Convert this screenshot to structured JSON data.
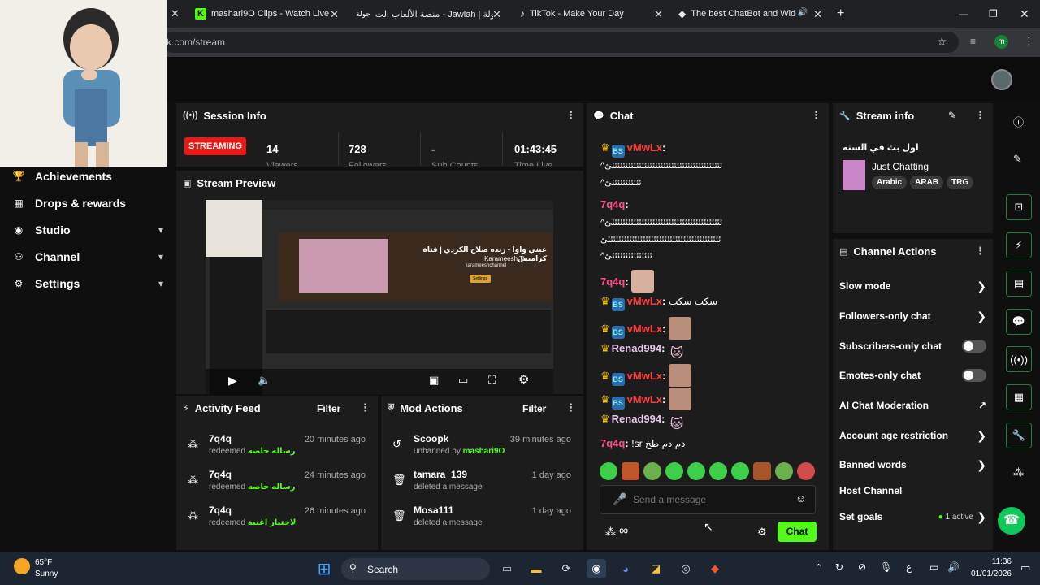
{
  "browser": {
    "tabs": [
      {
        "title": "mashari9O Clips - Watch Live o",
        "icon": "kick-icon"
      },
      {
        "title": "منصة الألعاب الت - Jawlah | جولة",
        "icon": "jawlah-icon"
      },
      {
        "title": "TikTok - Make Your Day",
        "icon": "tiktok-icon"
      },
      {
        "title": "The best ChatBot and Widg",
        "icon": "botrix-icon"
      }
    ],
    "url": "k.com/stream",
    "profile_initial": "m"
  },
  "sidebar": {
    "items": [
      {
        "label": "Achievements",
        "icon": "trophy-icon"
      },
      {
        "label": "Drops & rewards",
        "icon": "gift-icon"
      },
      {
        "label": "Studio",
        "icon": "studio-icon"
      },
      {
        "label": "Channel",
        "icon": "channel-icon"
      },
      {
        "label": "Settings",
        "icon": "gear-icon"
      }
    ]
  },
  "session": {
    "title": "Session Info",
    "status": "STREAMING",
    "stats": [
      {
        "value": "14",
        "label": "Viewers"
      },
      {
        "value": "728",
        "label": "Followers"
      },
      {
        "value": "-",
        "label": "Sub Counts"
      },
      {
        "value": "01:43:45",
        "label": "Time Live"
      }
    ]
  },
  "preview": {
    "title": "Stream Preview",
    "channel": "karameeshchannel",
    "video_title": "عبني واوا - رنده صلاح الكردي | قناة كراميش",
    "video_sub": "Karameesh Tv",
    "settings_btn": "Settings"
  },
  "activity": {
    "title": "Activity Feed",
    "filter": "Filter",
    "items": [
      {
        "user": "7q4q",
        "action": "redeemed",
        "reward": "رساله خاصه",
        "time": "20 minutes ago"
      },
      {
        "user": "7q4q",
        "action": "redeemed",
        "reward": "رساله خاصه",
        "time": "24 minutes ago"
      },
      {
        "user": "7q4q",
        "action": "redeemed",
        "reward": "لاختيار اغنية",
        "time": "26 minutes ago"
      }
    ]
  },
  "mod": {
    "title": "Mod Actions",
    "filter": "Filter",
    "items": [
      {
        "user": "Scoopk",
        "action": "unbanned by",
        "by": "mashari9O",
        "time": "39 minutes ago",
        "icon": "undo-icon"
      },
      {
        "user": "tamara_139",
        "action": "deleted a message",
        "by": "",
        "time": "1 day ago",
        "icon": "trash-icon"
      },
      {
        "user": "Mosa111",
        "action": "deleted a message",
        "by": "",
        "time": "1 day ago",
        "icon": "trash-icon"
      }
    ]
  },
  "chat": {
    "title": "Chat",
    "messages": [
      {
        "user": "vMwLx",
        "text": ""
      },
      {
        "user": "",
        "text": "^ئئئئئئئئئئئئئئئئئئئئئئئئئئئئئئئئئئئئئئئئئئ"
      },
      {
        "user": "",
        "text": "^ئئئئئئئئئئئئ"
      },
      {
        "user": "7q4q",
        "text": ""
      },
      {
        "user": "",
        "text": "^ئئئئئئئئئئئئئئئئئئئئئئئئئئئئئئئئئئئئئئئئئئ"
      },
      {
        "user": "",
        "text": "ئئئئئئئئئئئئئئئئئئئئئئئئئئئئئئئئئئئئئئئئئئئ"
      },
      {
        "user": "",
        "text": "^ئئئئئئئئئئئئئئئئ"
      },
      {
        "user": "7q4q",
        "text": ""
      },
      {
        "user": "vMwLx",
        "text": "سكب سكب"
      },
      {
        "user": "vMwLx",
        "text": ""
      },
      {
        "user": "Renad994",
        "text": ""
      },
      {
        "user": "vMwLx",
        "text": ""
      },
      {
        "user": "vMwLx",
        "text": ""
      },
      {
        "user": "Renad994",
        "text": ""
      },
      {
        "user": "7q4q",
        "text": "!sr دم دم طخ"
      }
    ],
    "placeholder": "Send a message",
    "send_label": "Chat"
  },
  "stream_info": {
    "title": "Stream info",
    "stream_title": "اول بث في السنه",
    "category": "Just Chatting",
    "tags": [
      "Arabic",
      "ARAB",
      "TRG"
    ]
  },
  "channel_actions": {
    "title": "Channel Actions",
    "items": [
      {
        "label": "Slow mode",
        "control": "chevron"
      },
      {
        "label": "Followers-only chat",
        "control": "chevron"
      },
      {
        "label": "Subscribers-only chat",
        "control": "toggle"
      },
      {
        "label": "Emotes-only chat",
        "control": "toggle"
      },
      {
        "label": "AI Chat Moderation",
        "control": "external"
      },
      {
        "label": "Account age restriction",
        "control": "chevron"
      },
      {
        "label": "Banned words",
        "control": "chevron"
      },
      {
        "label": "Host Channel",
        "control": "none"
      },
      {
        "label": "Set goals",
        "control": "chevron"
      }
    ],
    "goals_status": "1 active"
  },
  "taskbar": {
    "weather_temp": "65°F",
    "weather_desc": "Sunny",
    "search": "Search",
    "time": "11:36",
    "date": "01/01/2026",
    "lang": "ع"
  },
  "colors": {
    "accent": "#53fc18",
    "live": "#e91916",
    "panel": "#1c1c1c"
  }
}
